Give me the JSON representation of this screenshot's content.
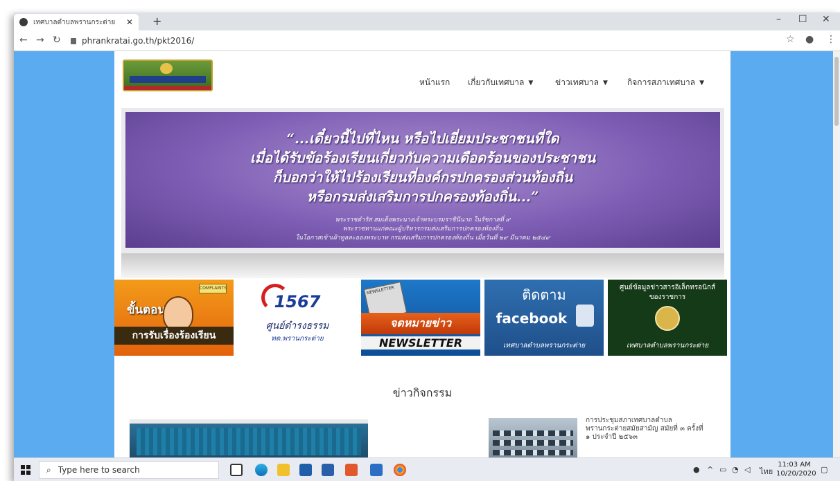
{
  "browser": {
    "tab_title": "เทศบาลตำบลพรานกระต่าย",
    "url": "phrankratai.go.th/pkt2016/"
  },
  "site": {
    "nav": [
      {
        "label": "หน้าแรก",
        "has_dropdown": false
      },
      {
        "label": "เกี่ยวกับเทศบาล",
        "has_dropdown": true
      },
      {
        "label": "ข่าวเทศบาล",
        "has_dropdown": true
      },
      {
        "label": "กิจการสภาเทศบาล",
        "has_dropdown": true
      }
    ],
    "banner": {
      "lines": [
        "“...เดี๋ยวนี้ไปที่ไหน  หรือไปเยี่ยมประชาชนที่ใด",
        "เมื่อได้รับข้อร้องเรียนเกี่ยวกับความเดือดร้อนของประชาชน",
        "ก็บอกว่าให้ไปร้องเรียนที่องค์กรปกครองส่วนท้องถิ่น",
        "หรือกรมส่งเสริมการปกครองท้องถิ่น...”"
      ],
      "small_lines": [
        "พระราชดำรัส  สมเด็จพระนางเจ้าพระบรมราชินีนาถ  ในรัชกาลที่ ๙",
        "พระราชทานแก่คณะผู้บริหารกรมส่งเสริมการปกครองท้องถิ่น",
        "ในโอกาสเข้าเฝ้าทูลละอองพระบาท  กรมส่งเสริมการปกครองท้องถิ่น  เมื่อวันที่  ๒๙  มีนาคม  ๒๕๔๙"
      ]
    },
    "tiles": [
      {
        "line1": "ขั้นตอน",
        "line2": "การรับเรื่องร้องเรียน",
        "sign": "COMPLAINTS"
      },
      {
        "number": "1567",
        "line1": "ศูนย์ดำรงธรรม",
        "line2": "ทต.พรานกระต่าย"
      },
      {
        "line1": "จดหมายข่าว",
        "line2": "NEWSLETTER",
        "tag": "NEWSLETTER"
      },
      {
        "line1": "ติดตาม",
        "line2": "facebook",
        "line3": "เทศบาลตำบลพรานกระต่าย"
      },
      {
        "line1": "ศูนย์ข้อมูลข่าวสารอิเล็กทรอนิกส์",
        "line2": "ของราชการ",
        "line3": "เทศบาลตำบลพรานกระต่าย"
      }
    ],
    "section_title": "ข่าวกิจกรรม",
    "news_item": "การประชุมสภาเทศบาลตำบลพรานกระต่ายสมัยสามัญ สมัยที่ ๓ ครั้งที่ ๑ ประจำปี ๒๕๖๓"
  },
  "taskbar": {
    "search_placeholder": "Type here to search",
    "lang": "ไทย",
    "time": "11:03 AM",
    "date": "10/20/2020"
  },
  "colors": {
    "page_bg": "#5aabf0",
    "banner_purple": "#7f5fb5"
  }
}
